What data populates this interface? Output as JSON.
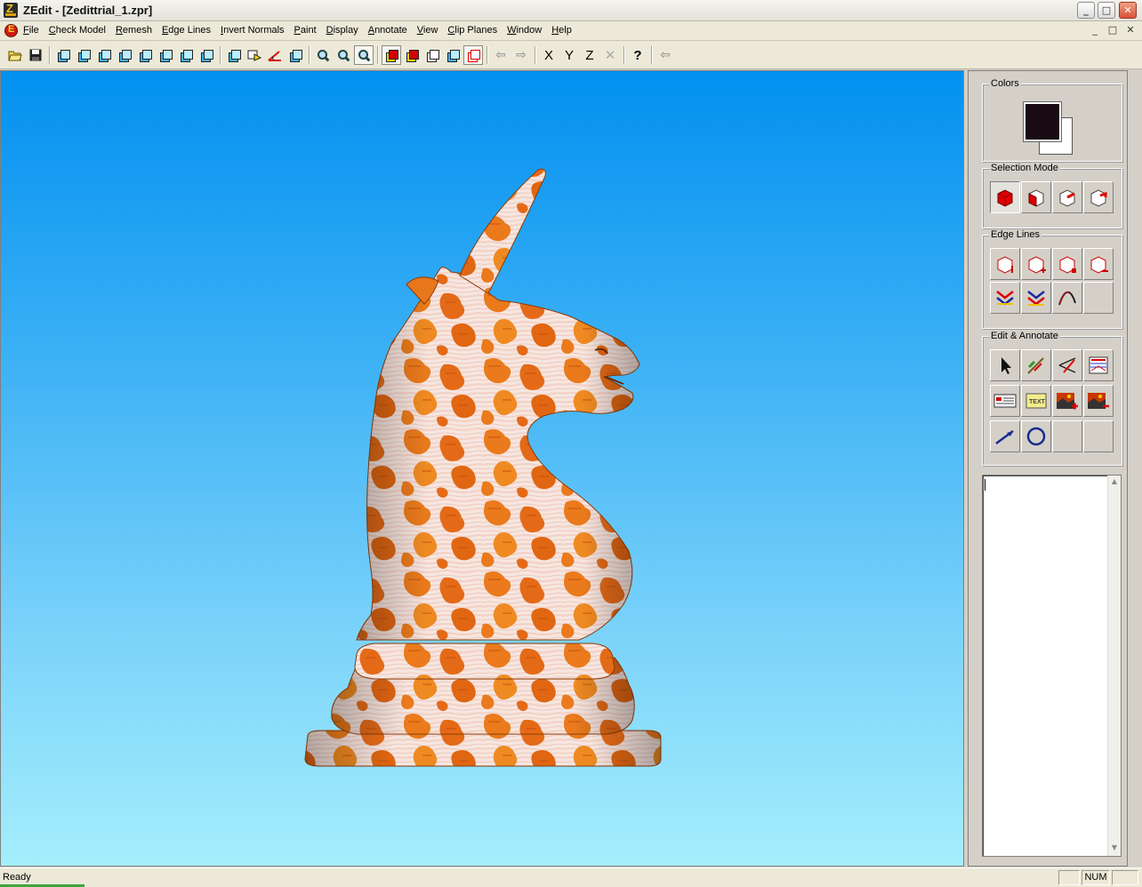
{
  "window": {
    "title": "ZEdit - [Zedittrial_1.zpr]",
    "minimize": "_",
    "maximize": "□",
    "close": "✕"
  },
  "menubar": {
    "items": [
      "File",
      "Check Model",
      "Remesh",
      "Edge Lines",
      "Invert Normals",
      "Paint",
      "Display",
      "Annotate",
      "View",
      "Clip Planes",
      "Window",
      "Help"
    ],
    "mdi": [
      "_",
      "□",
      "✕"
    ]
  },
  "toolbar": {
    "axis_x": "X",
    "axis_y": "Y",
    "axis_z": "Z",
    "axis_close": "✕",
    "help": "?"
  },
  "panel": {
    "colors": {
      "label": "Colors",
      "foreground": "#1a0a14",
      "background": "#ffffff"
    },
    "selection_mode": {
      "label": "Selection Mode"
    },
    "edge_lines": {
      "label": "Edge Lines"
    },
    "edit_annotate": {
      "label": "Edit & Annotate",
      "text_tool": "TEXT"
    },
    "notes": {
      "value": ""
    }
  },
  "viewport": {
    "model": "unicorn chess knight",
    "background_top": "#0290f0",
    "background_bottom": "#a4eefc",
    "texture_base": "#f6e8e4",
    "texture_pattern": "#e9781e"
  },
  "status": {
    "text": "Ready",
    "num": "NUM"
  }
}
